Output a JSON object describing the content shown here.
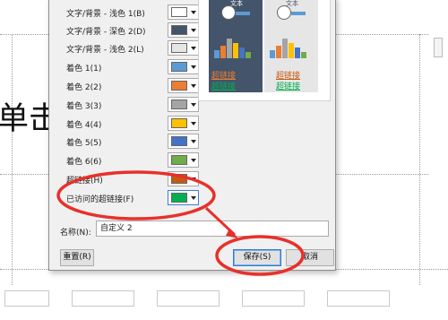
{
  "colors": {
    "dark2": "#44546a",
    "light2": "#e7e6e6",
    "accent1": "#5b9bd5",
    "accent2": "#ed7d31",
    "accent3": "#a5a5a5",
    "accent4": "#ffc000",
    "accent5": "#4472c4",
    "accent6": "#70ad47",
    "hyperlink": "#c55a11",
    "followed": "#00b050",
    "annotation": "#e8302a"
  },
  "rows": [
    {
      "label": "文字/背景 - 浅色 1(B)",
      "color": "#ffffff"
    },
    {
      "label": "文字/背景 - 深色 2(D)",
      "color": "#44546a"
    },
    {
      "label": "文字/背景 - 浅色 2(L)",
      "color": "#e7e6e6"
    },
    {
      "label": "着色 1(1)",
      "color": "#5b9bd5"
    },
    {
      "label": "着色 2(2)",
      "color": "#ed7d31"
    },
    {
      "label": "着色 3(3)",
      "color": "#a5a5a5"
    },
    {
      "label": "着色 4(4)",
      "color": "#ffc000"
    },
    {
      "label": "着色 5(5)",
      "color": "#4472c4"
    },
    {
      "label": "着色 6(6)",
      "color": "#70ad47"
    },
    {
      "label": "超链接(H)",
      "color": "#c55a11"
    },
    {
      "label": "已访问的超链接(F)",
      "color": "#00b050"
    }
  ],
  "preview": {
    "text_label": "文本",
    "hyperlink": "超链接",
    "followed": "超链接"
  },
  "name_field": {
    "label": "名称(N):",
    "value": "自定义 2"
  },
  "buttons": {
    "reset": "重置(R)",
    "save": "保存(S)",
    "cancel": "取消"
  },
  "background": {
    "slide_char": "单击"
  }
}
